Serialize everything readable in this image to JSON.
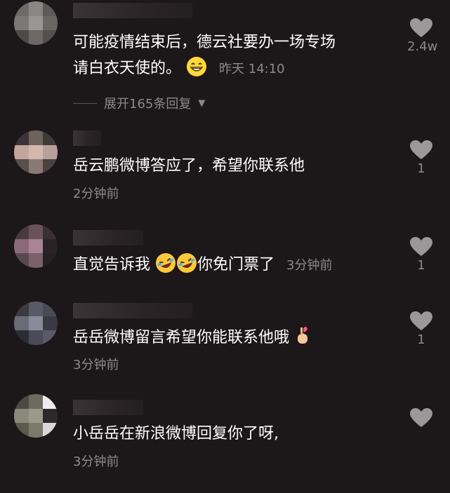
{
  "comments": [
    {
      "text": "可能疫情结束后，德云社要办一场专场",
      "text2": "请白衣天使的。",
      "emoji": "grinning-face",
      "time": "昨天 14:10",
      "likes": "2.4w",
      "expand_label": "展开165条回复"
    },
    {
      "text": "岳云鹏微博答应了，希望你联系他",
      "time": "2分钟前",
      "likes": "1"
    },
    {
      "text_a": "直觉告诉我",
      "emoji": "rolling-on-floor-laughing",
      "text_b": "你免门票了",
      "time": "3分钟前",
      "likes": "1"
    },
    {
      "text": "岳岳微博留言希望你能联系他哦",
      "emoji": "hand-with-index-finger-and-thumb-crossed",
      "time": "3分钟前",
      "likes": "1"
    },
    {
      "text": "小岳岳在新浪微博回复你了呀,",
      "time": "3分钟前",
      "likes": ""
    }
  ]
}
